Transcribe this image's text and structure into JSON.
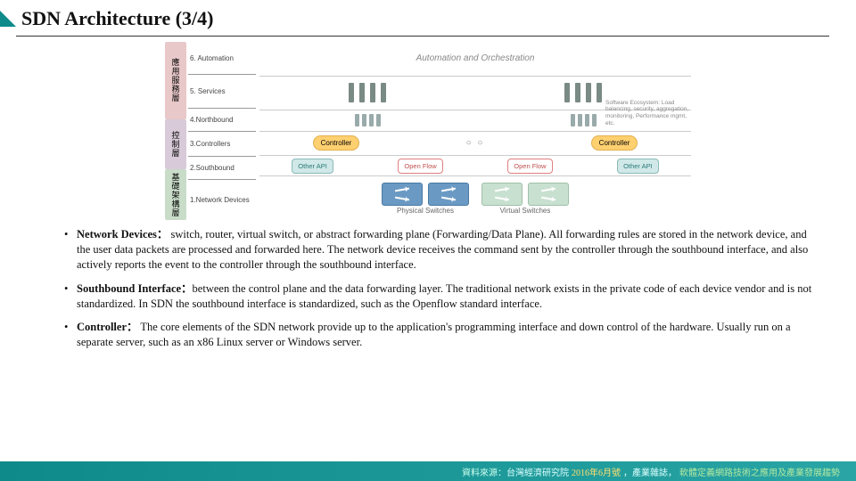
{
  "title": "SDN Architecture (3/4)",
  "diagram": {
    "side_layers": [
      "應用服務層",
      "控制層",
      "基礎架構層"
    ],
    "row_labels": [
      "6. Automation",
      "5. Services",
      "4.Northbound",
      "3.Controllers",
      "2.Southbound",
      "1.Network Devices"
    ],
    "top_header": "Automation and Orchestration",
    "ecosystem_note": "Software Ecosystem: Load balancing, security, aggregation, monitoring, Performance mgmt, etc.",
    "controller_label": "Controller",
    "api_other": "Other API",
    "api_openflow": "Open Flow",
    "phys_switch_caption": "Physical Switches",
    "virt_switch_caption": "Virtual Switches"
  },
  "bullets": [
    {
      "term": "Network Devices：",
      "text": " switch, router, virtual switch, or abstract forwarding plane (Forwarding/Data Plane). All forwarding rules are stored in the network device, and the user data packets are processed and forwarded here. The network device receives the command sent by the controller through the southbound interface, and also actively reports the event to the controller through the southbound interface."
    },
    {
      "term": "Southbound Interface：",
      "text": "between the control plane and the data forwarding layer. The traditional network exists in the private code of each device vendor and is not standardized. In SDN the southbound interface is standardized, such as the Openflow standard interface."
    },
    {
      "term": "Controller：",
      "text": " The core elements of the SDN network provide up to the application's programming interface and down control of the hardware. Usually run on a separate server, such as an x86 Linux server or Windows server."
    }
  ],
  "footer": {
    "label": "資料來源：",
    "src": "台灣經濟研究院",
    "year": "2016年6月號",
    "mid": "，產業雜誌，",
    "pub": "軟體定義網路技術之應用及產業發展趨勢"
  }
}
